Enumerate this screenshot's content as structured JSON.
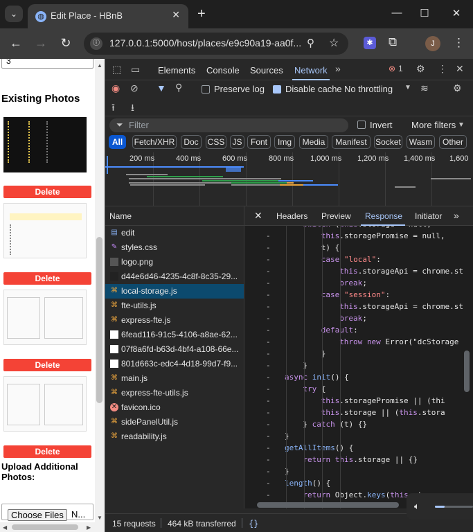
{
  "browser": {
    "tab_title": "Edit Place - HBnB",
    "url": "127.0.0.1:5000/host/places/e9c90a19-aa0f...",
    "profile_initial": "J"
  },
  "page": {
    "top_input_value": "3",
    "existing_photos_heading": "Existing Photos",
    "delete_label": "Delete",
    "upload_heading": "Upload Additional Photos:",
    "choose_files_label": "Choose Files",
    "no_file_text": "N..."
  },
  "devtools": {
    "tabs": [
      "Elements",
      "Console",
      "Sources",
      "Network"
    ],
    "active_tab": "Network",
    "error_count": "1",
    "toolbar": {
      "preserve_log": "Preserve log",
      "disable_cache": "Disable cache",
      "throttling": "No throttling"
    },
    "filter": {
      "placeholder": "Filter",
      "invert": "Invert",
      "more_filters": "More filters"
    },
    "type_filters": [
      "All",
      "Fetch/XHR",
      "Doc",
      "CSS",
      "JS",
      "Font",
      "Img",
      "Media",
      "Manifest",
      "Socket",
      "Wasm",
      "Other"
    ],
    "timeline_labels": [
      "200 ms",
      "400 ms",
      "600 ms",
      "800 ms",
      "1,000 ms",
      "1,200 ms",
      "1,400 ms",
      "1,600"
    ],
    "name_header": "Name",
    "requests": [
      {
        "name": "edit",
        "icon": "doc"
      },
      {
        "name": "styles.css",
        "icon": "css"
      },
      {
        "name": "logo.png",
        "icon": "img"
      },
      {
        "name": "d44e6d46-4235-4c8f-8c35-29...",
        "icon": "img-dark"
      },
      {
        "name": "local-storage.js",
        "icon": "js"
      },
      {
        "name": "fte-utils.js",
        "icon": "js"
      },
      {
        "name": "express-fte.js",
        "icon": "js"
      },
      {
        "name": "6fead116-91c5-4106-a8ae-62...",
        "icon": "img-white"
      },
      {
        "name": "07f8a6fd-b63d-4bf4-a108-66e...",
        "icon": "img-white"
      },
      {
        "name": "801d663c-edc4-4d18-99d7-f9...",
        "icon": "img-white"
      },
      {
        "name": "main.js",
        "icon": "js"
      },
      {
        "name": "express-fte-utils.js",
        "icon": "js"
      },
      {
        "name": "favicon.ico",
        "icon": "error"
      },
      {
        "name": "sidePanelUtil.js",
        "icon": "js"
      },
      {
        "name": "readability.js",
        "icon": "js"
      }
    ],
    "selected_request": "local-storage.js",
    "response_tabs": [
      "Headers",
      "Preview",
      "Response",
      "Initiator"
    ],
    "active_response_tab": "Response",
    "status": {
      "requests": "15 requests",
      "transferred": "464 kB transferred"
    },
    "code_lines": [
      "switch (this.storage = null,",
      "this.storagePromise = null,",
      "t) {",
      "case \"local\":",
      "this.storageApi = chrome.st",
      "break;",
      "case \"session\":",
      "this.storageApi = chrome.st",
      "break;",
      "default:",
      "throw new Error(\"dcStorage",
      "}",
      "}",
      "async init() {",
      "try {",
      "this.storagePromise || (thi",
      "this.storage || (this.stora",
      "} catch (t) {}",
      "}",
      "getAllItems() {",
      "return this.storage || {}",
      "}",
      "length() {",
      "return Object.keys(this.storag"
    ]
  }
}
